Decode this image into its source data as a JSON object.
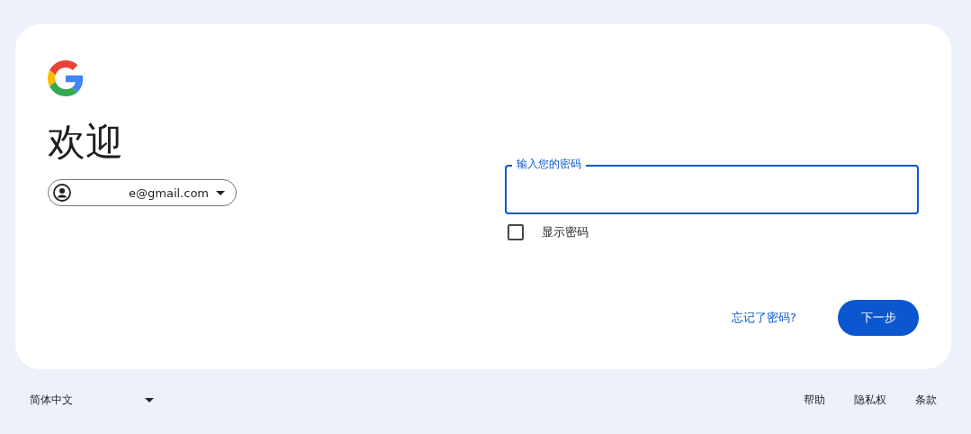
{
  "heading": "欢迎",
  "account": {
    "email": "e@gmail.com"
  },
  "password_field": {
    "label": "输入您的密码"
  },
  "show_password": {
    "label": "显示密码",
    "checked": false
  },
  "links": {
    "forgot": "忘记了密码?"
  },
  "buttons": {
    "next": "下一步"
  },
  "footer": {
    "language": "简体中文",
    "links": [
      "帮助",
      "隐私权",
      "条款"
    ]
  }
}
